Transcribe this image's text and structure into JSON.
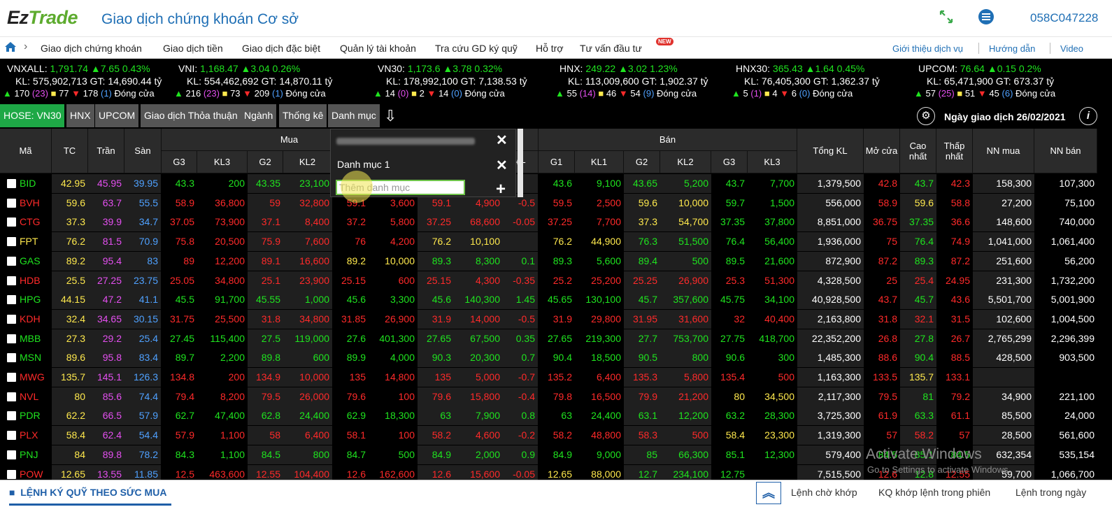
{
  "header": {
    "logo_ez": "Ez",
    "logo_trade": "Trade",
    "title": "Giao dịch chứng khoán Cơ sở",
    "account": "058C047228",
    "expand_icon": "expand-arrows-icon",
    "menu_icon": "hamburger-menu-icon"
  },
  "nav": {
    "items": [
      "Giao dịch chứng khoán",
      "Giao dịch tiền",
      "Giao dịch đặc biệt",
      "Quản lý tài khoản",
      "Tra cứu GD ký quỹ",
      "Hỗ trợ",
      "Tư vấn đầu tư"
    ],
    "new_badge": "NEW",
    "right_items": [
      "Giới thiệu dịch vụ",
      "Hướng dẫn",
      "Video"
    ]
  },
  "indices": [
    {
      "name": "VNXALL:",
      "value": "1,791.74",
      "chg": "7.65",
      "pct": "0.43%",
      "kl": "KL: 575,902,713 GT: 14,690.44 tỷ",
      "up": "170",
      "ceil": "(23)",
      "flat": "77",
      "down": "178",
      "floor": "(1)",
      "status": "Đóng cửa"
    },
    {
      "name": "VNI:",
      "value": "1,168.47",
      "chg": "3.04",
      "pct": "0.26%",
      "kl": "KL: 554,462,692 GT: 14,870.11 tỷ",
      "up": "216",
      "ceil": "(23)",
      "flat": "73",
      "down": "209",
      "floor": "(1)",
      "status": "Đóng cửa"
    },
    {
      "name": "VN30:",
      "value": "1,173.6",
      "chg": "3.78",
      "pct": "0.32%",
      "kl": "KL: 178,992,100 GT: 7,138.53 tỷ",
      "up": "14",
      "ceil": "(0)",
      "flat": "2",
      "down": "14",
      "floor": "(0)",
      "status": "Đóng cửa"
    },
    {
      "name": "HNX:",
      "value": "249.22",
      "chg": "3.02",
      "pct": "1.23%",
      "kl": "KL: 113,009,600 GT: 1,902.37 tỷ",
      "up": "55",
      "ceil": "(14)",
      "flat": "46",
      "down": "54",
      "floor": "(9)",
      "status": "Đóng cửa"
    },
    {
      "name": "HNX30:",
      "value": "365.43",
      "chg": "1.64",
      "pct": "0.45%",
      "kl": "KL: 76,405,300 GT: 1,362.37 tỷ",
      "up": "5",
      "ceil": "(1)",
      "flat": "4",
      "down": "6",
      "floor": "(0)",
      "status": "Đóng cửa"
    },
    {
      "name": "UPCOM:",
      "value": "76.64",
      "chg": "0.15",
      "pct": "0.2%",
      "kl": "KL: 65,471,900 GT: 673.37 tỷ",
      "up": "57",
      "ceil": "(25)",
      "flat": "51",
      "down": "45",
      "floor": "(6)",
      "status": "Đóng cửa"
    }
  ],
  "tabs": [
    "HOSE: VN30",
    "HNX",
    "UPCOM",
    "Giao dịch Thỏa thuận",
    "Ngành",
    "Thống kê",
    "Danh mục"
  ],
  "trade_date": "Ngày giao dịch 26/02/2021",
  "table": {
    "headers": {
      "ma": "Mã",
      "tc": "TC",
      "tran": "Trần",
      "san": "Sàn",
      "mua": "Mua",
      "ban": "Bán",
      "g3": "G3",
      "kl3": "KL3",
      "g2": "G2",
      "kl2": "KL2",
      "g1": "G1",
      "kl1": "KL1",
      "pm": "+/-",
      "tongkl": "Tổng KL",
      "mocua": "Mở cửa",
      "cao": "Cao nhất",
      "thap": "Thấp nhất",
      "nnmua": "NN mua",
      "nnban": "NN bán"
    },
    "rows": [
      [
        "BID",
        "42.95",
        "45.95",
        "39.95",
        "43.3",
        "200",
        "43.35",
        "23,100",
        "",
        "",
        "",
        "",
        "",
        "43.6",
        "9,100",
        "43.65",
        "5,200",
        "43.7",
        "7,700",
        "1,379,500",
        "42.8",
        "43.7",
        "42.3",
        "158,300",
        "107,300"
      ],
      [
        "BVH",
        "59.6",
        "63.7",
        "55.5",
        "58.9",
        "36,800",
        "59",
        "32,800",
        "59.1",
        "3,600",
        "59.1",
        "4,900",
        "-0.5",
        "59.5",
        "2,500",
        "59.6",
        "10,000",
        "59.7",
        "1,500",
        "556,000",
        "58.9",
        "59.6",
        "58.8",
        "27,200",
        "75,100"
      ],
      [
        "CTG",
        "37.3",
        "39.9",
        "34.7",
        "37.05",
        "73,900",
        "37.1",
        "8,400",
        "37.2",
        "5,800",
        "37.25",
        "68,600",
        "-0.05",
        "37.25",
        "7,700",
        "37.3",
        "54,700",
        "37.35",
        "37,800",
        "8,851,000",
        "36.75",
        "37.35",
        "36.6",
        "148,600",
        "740,000"
      ],
      [
        "FPT",
        "76.2",
        "81.5",
        "70.9",
        "75.8",
        "20,500",
        "75.9",
        "7,600",
        "76",
        "4,200",
        "76.2",
        "10,100",
        "",
        "76.2",
        "44,900",
        "76.3",
        "51,500",
        "76.4",
        "56,400",
        "1,936,000",
        "75",
        "76.4",
        "74.9",
        "1,041,000",
        "1,061,400"
      ],
      [
        "GAS",
        "89.2",
        "95.4",
        "83",
        "89",
        "12,200",
        "89.1",
        "16,600",
        "89.2",
        "10,000",
        "89.3",
        "8,300",
        "0.1",
        "89.3",
        "5,600",
        "89.4",
        "500",
        "89.5",
        "21,600",
        "872,900",
        "87.2",
        "89.3",
        "87.2",
        "251,600",
        "56,200"
      ],
      [
        "HDB",
        "25.5",
        "27.25",
        "23.75",
        "25.05",
        "34,800",
        "25.1",
        "23,900",
        "25.15",
        "600",
        "25.15",
        "4,300",
        "-0.35",
        "25.2",
        "25,200",
        "25.25",
        "26,900",
        "25.3",
        "51,300",
        "4,328,500",
        "25",
        "25.4",
        "24.95",
        "231,300",
        "1,732,200"
      ],
      [
        "HPG",
        "44.15",
        "47.2",
        "41.1",
        "45.5",
        "91,700",
        "45.55",
        "1,000",
        "45.6",
        "3,300",
        "45.6",
        "140,300",
        "1.45",
        "45.65",
        "130,100",
        "45.7",
        "357,600",
        "45.75",
        "34,100",
        "40,928,500",
        "43.7",
        "45.7",
        "43.6",
        "5,501,700",
        "5,001,900"
      ],
      [
        "KDH",
        "32.4",
        "34.65",
        "30.15",
        "31.75",
        "25,500",
        "31.8",
        "34,800",
        "31.85",
        "26,900",
        "31.9",
        "14,000",
        "-0.5",
        "31.9",
        "29,800",
        "31.95",
        "31,600",
        "32",
        "40,400",
        "2,163,800",
        "31.8",
        "32.1",
        "31.5",
        "102,600",
        "1,004,500"
      ],
      [
        "MBB",
        "27.3",
        "29.2",
        "25.4",
        "27.45",
        "115,400",
        "27.5",
        "119,000",
        "27.6",
        "401,300",
        "27.65",
        "67,500",
        "0.35",
        "27.65",
        "219,300",
        "27.7",
        "753,700",
        "27.75",
        "418,700",
        "22,352,200",
        "26.8",
        "27.8",
        "26.7",
        "2,765,299",
        "2,296,399"
      ],
      [
        "MSN",
        "89.6",
        "95.8",
        "83.4",
        "89.7",
        "2,200",
        "89.8",
        "600",
        "89.9",
        "4,000",
        "90.3",
        "20,300",
        "0.7",
        "90.4",
        "18,500",
        "90.5",
        "800",
        "90.6",
        "300",
        "1,485,300",
        "88.6",
        "90.4",
        "88.5",
        "428,500",
        "903,500"
      ],
      [
        "MWG",
        "135.7",
        "145.1",
        "126.3",
        "134.8",
        "200",
        "134.9",
        "10,000",
        "135",
        "14,800",
        "135",
        "5,000",
        "-0.7",
        "135.2",
        "6,400",
        "135.3",
        "5,800",
        "135.4",
        "500",
        "1,163,300",
        "133.5",
        "135.7",
        "133.1",
        "",
        ""
      ],
      [
        "NVL",
        "80",
        "85.6",
        "74.4",
        "79.4",
        "8,200",
        "79.5",
        "26,000",
        "79.6",
        "100",
        "79.6",
        "15,800",
        "-0.4",
        "79.8",
        "16,500",
        "79.9",
        "21,200",
        "80",
        "34,500",
        "2,117,300",
        "79.5",
        "81",
        "79.2",
        "34,900",
        "221,100"
      ],
      [
        "PDR",
        "62.2",
        "66.5",
        "57.9",
        "62.7",
        "47,400",
        "62.8",
        "24,400",
        "62.9",
        "18,300",
        "63",
        "7,900",
        "0.8",
        "63",
        "24,400",
        "63.1",
        "12,200",
        "63.2",
        "28,300",
        "3,725,300",
        "61.9",
        "63.3",
        "61.1",
        "85,500",
        "24,000"
      ],
      [
        "PLX",
        "58.4",
        "62.4",
        "54.4",
        "57.9",
        "1,100",
        "58",
        "6,400",
        "58.1",
        "100",
        "58.2",
        "4,600",
        "-0.2",
        "58.2",
        "48,800",
        "58.3",
        "500",
        "58.4",
        "23,300",
        "1,319,300",
        "57",
        "58.2",
        "57",
        "28,500",
        "561,600"
      ],
      [
        "PNJ",
        "84",
        "89.8",
        "78.2",
        "84.3",
        "1,100",
        "84.5",
        "800",
        "84.7",
        "500",
        "84.9",
        "2,000",
        "0.9",
        "84.9",
        "9,000",
        "85",
        "66,300",
        "85.1",
        "12,300",
        "579,400",
        "84.5",
        "85.1",
        "84.5",
        "632,354",
        "535,154"
      ],
      [
        "POW",
        "12.65",
        "13.55",
        "11.85",
        "12.5",
        "463,600",
        "12.55",
        "104,400",
        "12.6",
        "162,600",
        "12.6",
        "15,600",
        "-0.05",
        "12.65",
        "88,000",
        "12.7",
        "234,100",
        "12.75",
        "",
        "7,515,500",
        "12.6",
        "12.8",
        "12.55",
        "59,700",
        "1,066,700"
      ]
    ]
  },
  "dropdown": {
    "list_name": "Danh mục 1",
    "input_placeholder": "Thêm danh mục",
    "close_icon": "close-icon",
    "add_icon": "plus-icon"
  },
  "watermark": {
    "line1": "Activate Windows",
    "line2": "Go to Settings to activate Windows."
  },
  "footer": {
    "left_label": "LỆNH KÝ QUỸ THEO SỨC MUA",
    "links": [
      "Lệnh chờ khớp",
      "KQ khớp lệnh trong phiên",
      "Lệnh trong ngày"
    ],
    "toggle_icon": "double-chevron-up-icon"
  },
  "colors": {
    "up": "#1fe41f",
    "ref": "#ffe94d",
    "down": "#ff2a2a",
    "ceiling": "#e44ff0",
    "floor": "#4fa1ff",
    "active_tab": "#1ea846",
    "brand": "#1f6fb5"
  }
}
